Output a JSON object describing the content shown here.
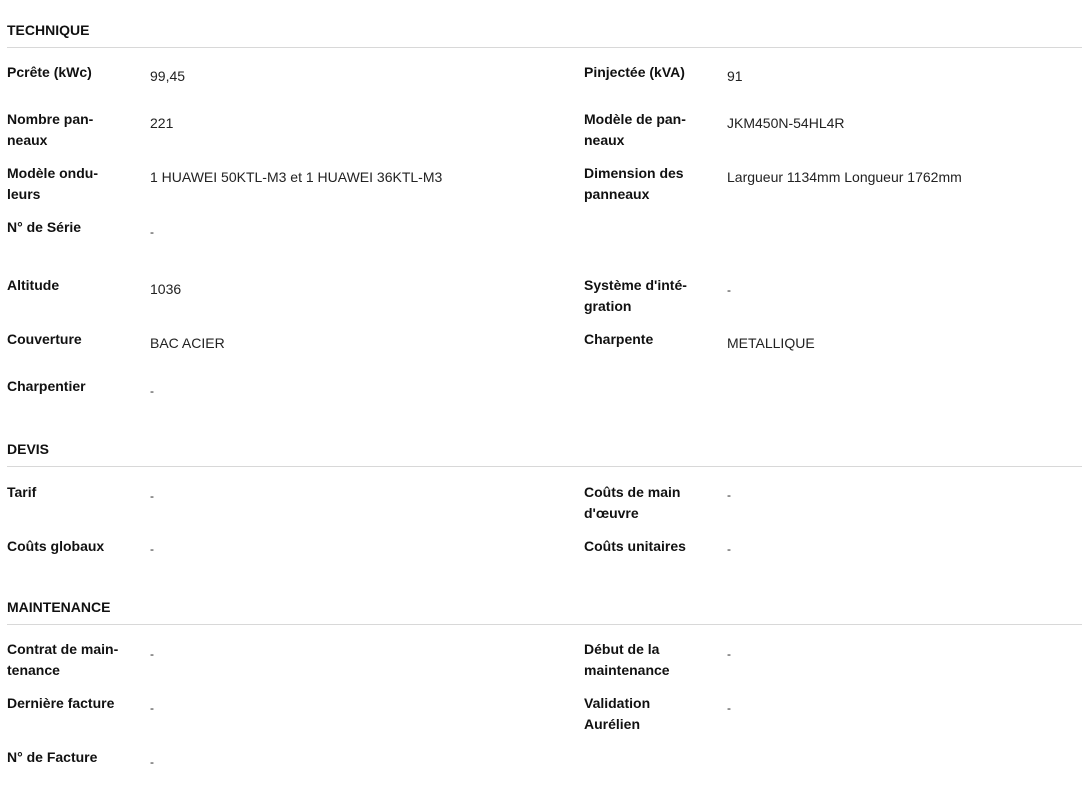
{
  "technique": {
    "title": "TECHNIQUE",
    "pcrete_label": "Pcrête (kWc)",
    "pcrete_value": "99,45",
    "pinjectee_label": "Pinjectée (kVA)",
    "pinjectee_value": "91",
    "nb_panneaux_label_1": "Nombre pan-",
    "nb_panneaux_label_2": "neaux",
    "nb_panneaux_value": "221",
    "modele_panneaux_label_1": "Modèle de pan-",
    "modele_panneaux_label_2": "neaux",
    "modele_panneaux_value": "JKM450N-54HL4R",
    "modele_onduleurs_label_1": "Modèle ondu-",
    "modele_onduleurs_label_2": "leurs",
    "modele_onduleurs_value": "1 HUAWEI 50KTL-M3 et 1 HUAWEI 36KTL-M3",
    "dimension_label_1": "Dimension des",
    "dimension_label_2": "panneaux",
    "dimension_value": "Largueur 1134mm Longueur 1762mm",
    "serie_label": "N° de Série",
    "serie_value": "-",
    "altitude_label": "Altitude",
    "altitude_value": "1036",
    "integration_label_1": "Système d'inté-",
    "integration_label_2": "gration",
    "integration_value": "-",
    "couverture_label": "Couverture",
    "couverture_value": "BAC ACIER",
    "charpente_label": "Charpente",
    "charpente_value": "METALLIQUE",
    "charpentier_label": "Charpentier",
    "charpentier_value": "-"
  },
  "devis": {
    "title": "DEVIS",
    "tarif_label": "Tarif",
    "tarif_value": "-",
    "main_oeuvre_label_1": "Coûts de main",
    "main_oeuvre_label_2": "d'œuvre",
    "main_oeuvre_value": "-",
    "globaux_label": "Coûts globaux",
    "globaux_value": "-",
    "unitaires_label": "Coûts unitaires",
    "unitaires_value": "-"
  },
  "maintenance": {
    "title": "MAINTENANCE",
    "contrat_label_1": "Contrat de main-",
    "contrat_label_2": "tenance",
    "contrat_value": "-",
    "debut_label_1": "Début de la",
    "debut_label_2": "maintenance",
    "debut_value": "-",
    "derniere_facture_label": "Dernière facture",
    "derniere_facture_value": "-",
    "validation_label_1": "Validation",
    "validation_label_2": "Aurélien",
    "validation_value": "-",
    "facture_label": "N° de Facture",
    "facture_value": "-"
  }
}
